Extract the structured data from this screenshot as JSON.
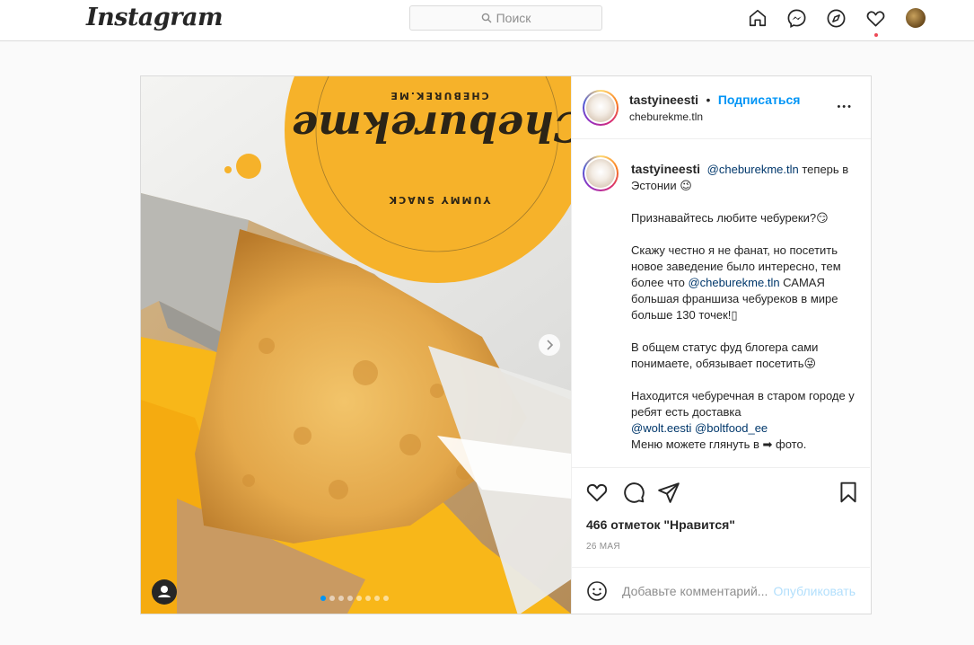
{
  "header": {
    "logo": "Instagram",
    "search_placeholder": "Поиск"
  },
  "post": {
    "username": "tastyineesti",
    "separator": "•",
    "follow_label": "Подписаться",
    "location": "cheburekme.tln",
    "more": "•••",
    "photo_brand_text": "Cheburekme",
    "photo_ring_text_top": "CHEBUREK.ME",
    "photo_ring_text_bottom": "YUMMY SNACK",
    "caption": {
      "author": "tastyineesti",
      "mention1": "@cheburekme.tln",
      "line1_rest": " теперь в Эстонии 😉",
      "p2": "Признавайтесь любите чебуреки?😏",
      "p3_a": "Скажу честно я не фанат, но посетить новое заведение было интересно, тем более что ",
      "p3_mention": "@cheburekme.tln",
      "p3_b": " САМАЯ большая франшиза чебуреков в мире больше 130 точек!",
      "p3_end": "▯",
      "p4": "В общем статус фуд блогера сами понимаете, обязывает посетить😜",
      "p5_a": "Находится чебуречная в старом городе у ребят есть доставка",
      "p5_mention1": "@wolt.eesti",
      "p5_mention2": "@boltfood_ee",
      "p5_b": "Меню можете глянуть в ➡ фото."
    },
    "likes": "466 отметок \"Нравится\"",
    "date": "26 МАЯ",
    "comment_placeholder": "Добавьте комментарий...",
    "publish_label": "Опубликовать",
    "carousel_total": 8,
    "carousel_active": 1
  },
  "colors": {
    "accent": "#0095f6",
    "brand_yellow": "#f7b32b",
    "link": "#00376b"
  }
}
